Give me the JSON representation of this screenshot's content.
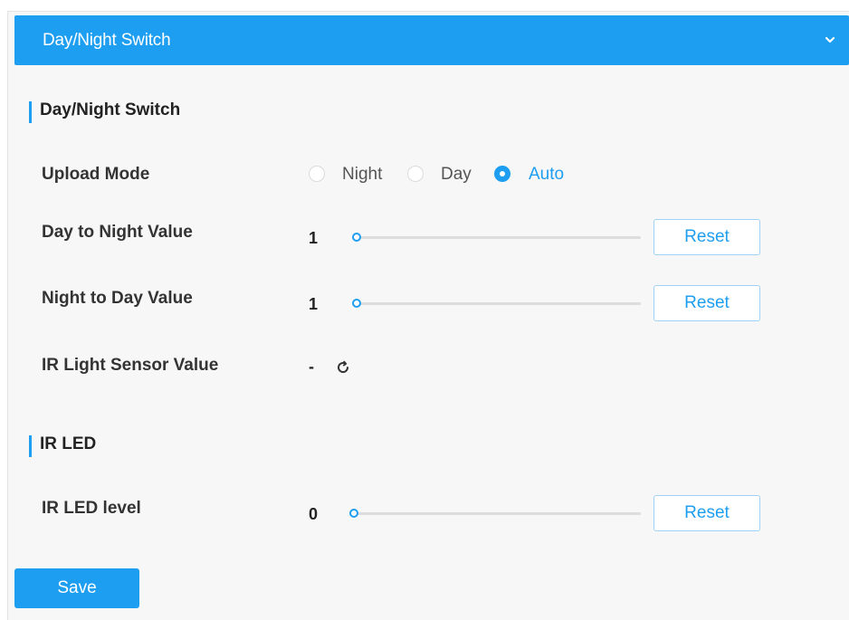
{
  "header": {
    "title": "Day/Night Switch"
  },
  "sections": {
    "day_night": {
      "title": "Day/Night Switch"
    },
    "ir_led": {
      "title": "IR LED"
    }
  },
  "upload_mode": {
    "label": "Upload Mode",
    "options": [
      "Night",
      "Day",
      "Auto"
    ],
    "selected": "Auto"
  },
  "day_to_night": {
    "label": "Day to Night Value",
    "value": "1",
    "reset_label": "Reset",
    "level": 0.01
  },
  "night_to_day": {
    "label": "Night to Day Value",
    "value": "1",
    "reset_label": "Reset",
    "level": 0.01
  },
  "ir_sensor": {
    "label": "IR Light Sensor Value",
    "value": "-"
  },
  "ir_led_level": {
    "label": "IR LED level",
    "value": "0",
    "reset_label": "Reset",
    "level": 0
  },
  "save_label": "Save",
  "colors": {
    "accent": "#1e9ef0",
    "panel_bg": "#f7f7f7"
  },
  "icons": {
    "header": "chevron-down-icon",
    "refresh": "refresh-icon"
  }
}
